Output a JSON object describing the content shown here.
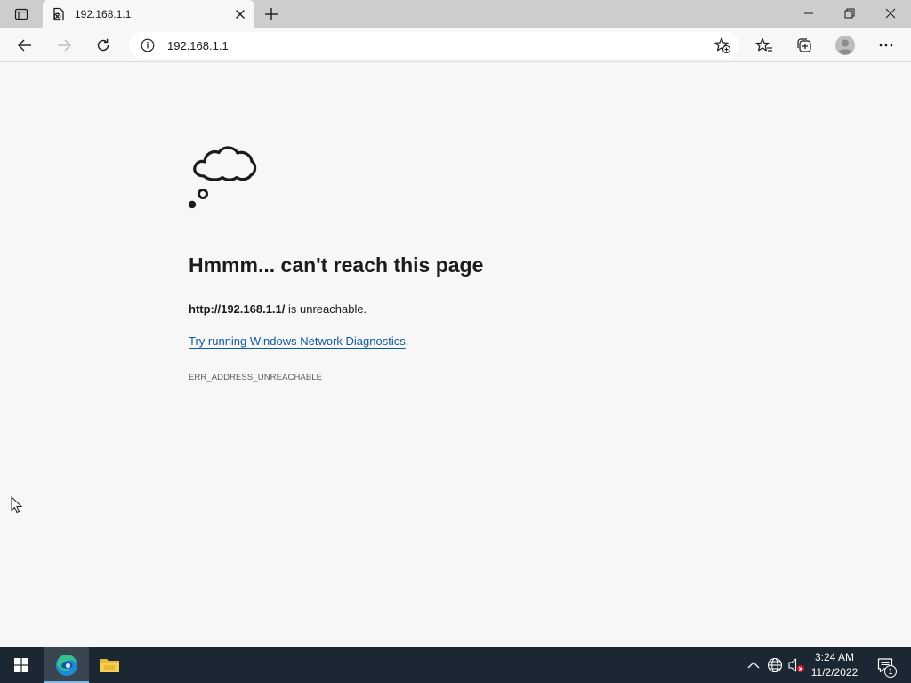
{
  "browser": {
    "tab": {
      "title": "192.168.1.1"
    },
    "address_bar": {
      "url": "192.168.1.1"
    }
  },
  "error_page": {
    "heading": "Hmmm... can't reach this page",
    "url_bold": "http://192.168.1.1/",
    "url_suffix": " is unreachable.",
    "diagnostics_link": "Try running Windows Network Diagnostics",
    "diagnostics_suffix": ".",
    "error_code": "ERR_ADDRESS_UNREACHABLE"
  },
  "taskbar": {
    "clock_time": "3:24 AM",
    "clock_date": "11/2/2022",
    "notification_count": "1"
  },
  "colors": {
    "link": "#0f5a99",
    "taskbar": "#1c2734",
    "tabstrip": "#cdcdcd",
    "page_bg": "#f7f7f7"
  },
  "icons": [
    "tab-actions-icon",
    "favicon-icon",
    "close-icon",
    "plus-icon",
    "minimize-icon",
    "restore-icon",
    "back-icon",
    "forward-icon",
    "refresh-icon",
    "info-icon",
    "add-favorite-icon",
    "favorites-icon",
    "collections-icon",
    "profile-icon",
    "more-icon",
    "cloud-icon",
    "windows-logo-icon",
    "edge-icon",
    "file-explorer-icon",
    "chevron-up-icon",
    "network-icon",
    "speaker-muted-icon",
    "notification-icon"
  ]
}
